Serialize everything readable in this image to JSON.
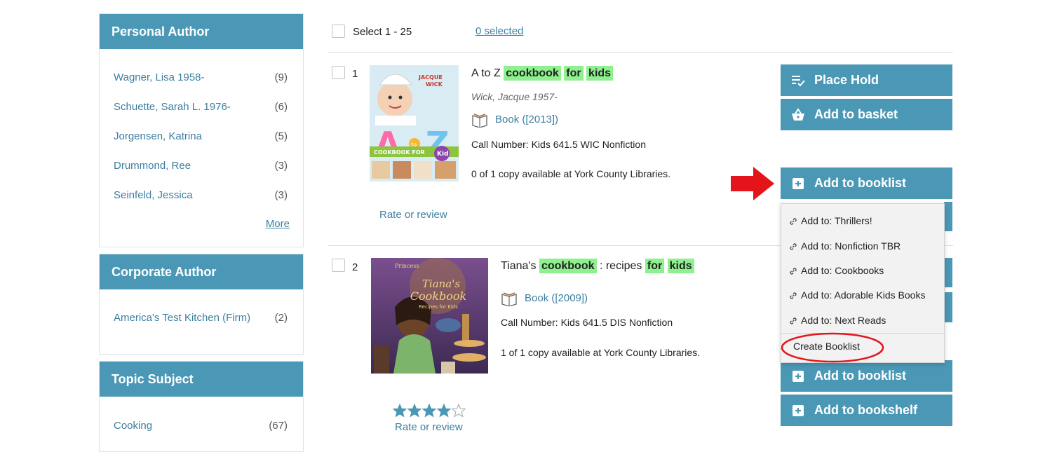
{
  "sidebar": {
    "personal_author": {
      "title": "Personal Author",
      "items": [
        {
          "name": "Wagner, Lisa 1958-",
          "count": "(9)"
        },
        {
          "name": "Schuette, Sarah L. 1976-",
          "count": "(6)"
        },
        {
          "name": "Jorgensen, Katrina",
          "count": "(5)"
        },
        {
          "name": "Drummond, Ree",
          "count": "(3)"
        },
        {
          "name": "Seinfeld, Jessica",
          "count": "(3)"
        }
      ],
      "more": "More"
    },
    "corporate_author": {
      "title": "Corporate Author",
      "items": [
        {
          "name": "America's Test Kitchen (Firm)",
          "count": "(2)"
        }
      ]
    },
    "topic_subject": {
      "title": "Topic Subject",
      "items": [
        {
          "name": "Cooking",
          "count": "(67)"
        }
      ]
    }
  },
  "results_header": {
    "select_label": "Select 1 - 25",
    "selected_label": "0 selected"
  },
  "results": [
    {
      "number": "1",
      "title_parts": [
        "A to Z",
        "cookbook",
        "for",
        "kids"
      ],
      "author": "Wick, Jacque 1957-",
      "format": "Book ([2013])",
      "call_number": "Call Number: Kids 641.5 WIC Nonfiction",
      "availability": "0 of 1 copy available at York County Libraries.",
      "rate_label": "Rate or review",
      "cover": {
        "brand": "JACQUE WICK",
        "letters": "A to Z",
        "subtitle": "COOKBOOK FOR",
        "kid_badge": "Kid"
      }
    },
    {
      "number": "2",
      "title_parts": [
        "Tiana's",
        "cookbook",
        ": recipes",
        "for",
        "kids"
      ],
      "format": "Book ([2009])",
      "call_number": "Call Number: Kids 641.5 DIS Nonfiction",
      "availability": "1 of 1 copy available at York County Libraries.",
      "rating": 4,
      "rating_max": 5,
      "rate_label": "Rate or review",
      "cover": {
        "title": "Tiana's Cookbook",
        "subtitle": "Recipes for Kids"
      }
    }
  ],
  "actions": {
    "place_hold": "Place Hold",
    "add_to_basket": "Add to basket",
    "add_to_booklist": "Add to booklist",
    "add_to_bookshelf": "Add to bookshelf"
  },
  "booklist_menu": {
    "items": [
      "Add to: Thrillers!",
      "Add to: Nonfiction TBR",
      "Add to: Cookbooks",
      "Add to: Adorable Kids Books",
      "Add to: Next Reads"
    ],
    "create": "Create Booklist"
  },
  "colors": {
    "accent": "#4a98b6",
    "link": "#3c7fa0",
    "highlight": "#8ef08e",
    "annotation_red": "#e3151b",
    "star": "#4a98b6"
  }
}
